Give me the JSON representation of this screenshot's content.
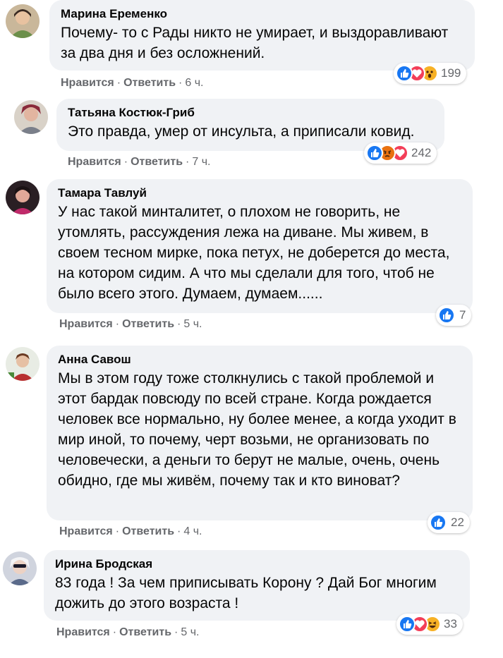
{
  "actions": {
    "like": "Нравится",
    "reply": "Ответить",
    "separator": "·"
  },
  "comments": [
    {
      "author": "Марина Еременко",
      "text": "Почему- то с Рады никто не умирает, и выздоравливают за два дня и без осложнений.",
      "time": "6 ч.",
      "reactions": [
        "like-icon",
        "love-icon",
        "wow-icon"
      ],
      "reaction_count": "199"
    },
    {
      "author": "Татьяна Костюк-Гриб",
      "text": "Это правда, умер от инсульта, а приписали ковид.",
      "time": "7 ч.",
      "reactions": [
        "like-icon",
        "angry-icon",
        "love-icon"
      ],
      "reaction_count": "242"
    },
    {
      "author": "Тамара Тавлуй",
      "text": "У нас такой минталитет, о плохом не говорить, не утомлять, рассуждения лежа на диване. Мы живем, в своем тесном мирке, пока петух, не доберется до места, на котором сидим. А что мы сделали для того, чтоб не было всего этого. Думаем, думаем......",
      "time": "5 ч.",
      "reactions": [
        "like-icon"
      ],
      "reaction_count": "7"
    },
    {
      "author": "Анна Савош",
      "text": "Мы в этом году тоже столкнулись с такой проблемой и этот бардак повсюду по всей стране. Когда рождается человек все нормально, ну более менее, а когда уходит в мир иной, то почему, черт возьми, не организовать по человечески, а деньги то берут не малые, очень, очень обидно, где мы живём, почему так и кто виноват?",
      "time": "4 ч.",
      "reactions": [
        "like-icon"
      ],
      "reaction_count": "22"
    },
    {
      "author": "Ирина Бродская",
      "text": "83 года ! За чем приписывать Корону ? Дай Бог многим дожить до этого возраста !",
      "time": "5 ч.",
      "reactions": [
        "like-icon",
        "love-icon",
        "haha-icon"
      ],
      "reaction_count": "33"
    }
  ],
  "colors": {
    "like": "#1877f2",
    "love": "#f33e58",
    "wow": "#f7b125",
    "angry": "#e9710f",
    "bubble": "#f0f2f5",
    "meta_text": "#65676b"
  }
}
